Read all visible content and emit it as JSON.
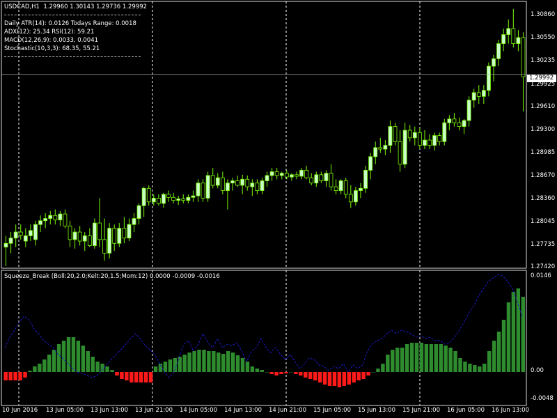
{
  "chart_header": {
    "symbol_line": "USDCAD,H1  1.29960 1.30143 1.29736 1.29992",
    "info_lines": [
      "Daily ATR(14): 0.0126 Todays Range: 0.0018",
      "ADX(12): 25.34 RSI(12): 59.21",
      "MACD(12,26,9): 0.0033, 0.0041",
      "Stochastic(10,3,3): 68.35, 55.21"
    ]
  },
  "colors": {
    "background": "#000000",
    "bull_candle": "#c8ffc8",
    "bear_candle": "#000000",
    "candle_wick": "#7cfc00",
    "momentum_up": "#2e8b2e",
    "momentum_down": "#ff1a1a",
    "bollinger_line": "#1c1cc8",
    "grid": "#ffffff",
    "current_price_bg": "#ffffff"
  },
  "current_price": "1.29992",
  "price_axis": [
    "1.30860",
    "1.30550",
    "1.30235",
    "1.29925",
    "1.29610",
    "1.29300",
    "1.28985",
    "1.28670",
    "1.28360",
    "1.28045",
    "1.27735",
    "1.27420"
  ],
  "indicator": {
    "label": "Squeeze_Break (Boll:20,2.0;Kelt:20,1.5;Mom:12) 0.0000 -0.0009 -0.0016",
    "axis": [
      "0.0146",
      "0.00",
      "-0.0048"
    ]
  },
  "time_axis": [
    "10 Jun 2016",
    "13 Jun 05:00",
    "13 Jun 13:00",
    "13 Jun 21:00",
    "14 Jun 05:00",
    "14 Jun 13:00",
    "14 Jun 21:00",
    "15 Jun 05:00",
    "15 Jun 13:00",
    "15 Jun 21:00",
    "16 Jun 05:00",
    "16 Jun 13:00"
  ],
  "chart_data": [
    {
      "type": "candlestick",
      "title": "USDCAD,H1  1.29960 1.30143 1.29736 1.29992",
      "ylim": [
        1.2742,
        1.3096
      ],
      "ohlc": [
        [
          1.277,
          1.2785,
          1.2745,
          1.2775
        ],
        [
          1.2775,
          1.279,
          1.2762,
          1.2782
        ],
        [
          1.2782,
          1.28,
          1.277,
          1.279
        ],
        [
          1.279,
          1.28,
          1.278,
          1.2786
        ],
        [
          1.2778,
          1.2795,
          1.277,
          1.2785
        ],
        [
          1.2785,
          1.28,
          1.2778,
          1.2792
        ],
        [
          1.278,
          1.2805,
          1.2772,
          1.28
        ],
        [
          1.28,
          1.2812,
          1.279,
          1.2805
        ],
        [
          1.2805,
          1.2815,
          1.2795,
          1.2808
        ],
        [
          1.2808,
          1.2818,
          1.28,
          1.2812
        ],
        [
          1.2812,
          1.282,
          1.28,
          1.2806
        ],
        [
          1.2806,
          1.2818,
          1.2798,
          1.2814
        ],
        [
          1.2814,
          1.282,
          1.2795,
          1.2798
        ],
        [
          1.2798,
          1.2805,
          1.277,
          1.278
        ],
        [
          1.278,
          1.2795,
          1.2768,
          1.279
        ],
        [
          1.279,
          1.2798,
          1.2772,
          1.2778
        ],
        [
          1.2778,
          1.279,
          1.2765,
          1.2785
        ],
        [
          1.2785,
          1.2795,
          1.277,
          1.2772
        ],
        [
          1.2772,
          1.2808,
          1.2768,
          1.2802
        ],
        [
          1.2802,
          1.2835,
          1.277,
          1.278
        ],
        [
          1.278,
          1.2808,
          1.2752,
          1.2762
        ],
        [
          1.2762,
          1.2802,
          1.2755,
          1.2795
        ],
        [
          1.2795,
          1.28,
          1.2765,
          1.2775
        ],
        [
          1.2775,
          1.2802,
          1.277,
          1.2795
        ],
        [
          1.2795,
          1.281,
          1.2775,
          1.2782
        ],
        [
          1.2782,
          1.2808,
          1.2778,
          1.28
        ],
        [
          1.28,
          1.2815,
          1.279,
          1.2808
        ],
        [
          1.2808,
          1.2828,
          1.28,
          1.2825
        ],
        [
          1.2825,
          1.285,
          1.281,
          1.2848
        ],
        [
          1.2848,
          1.2852,
          1.2825,
          1.283
        ],
        [
          1.283,
          1.284,
          1.2825,
          1.2835
        ],
        [
          1.2835,
          1.284,
          1.2825,
          1.2828
        ],
        [
          1.2828,
          1.2842,
          1.2822,
          1.284
        ],
        [
          1.284,
          1.2845,
          1.283,
          1.2836
        ],
        [
          1.2836,
          1.2842,
          1.2828,
          1.2832
        ],
        [
          1.2832,
          1.2838,
          1.2826,
          1.2834
        ],
        [
          1.2834,
          1.284,
          1.2828,
          1.2832
        ],
        [
          1.2832,
          1.284,
          1.2828,
          1.2836
        ],
        [
          1.2836,
          1.2845,
          1.283,
          1.2838
        ],
        [
          1.2838,
          1.286,
          1.283,
          1.2855
        ],
        [
          1.2855,
          1.286,
          1.283,
          1.2835
        ],
        [
          1.2835,
          1.287,
          1.283,
          1.2865
        ],
        [
          1.2865,
          1.2875,
          1.2848,
          1.2852
        ],
        [
          1.2852,
          1.2868,
          1.2848,
          1.2862
        ],
        [
          1.2862,
          1.287,
          1.284,
          1.2845
        ],
        [
          1.2845,
          1.286,
          1.282,
          1.2855
        ],
        [
          1.2855,
          1.2862,
          1.2845,
          1.2858
        ],
        [
          1.2858,
          1.2865,
          1.285,
          1.2852
        ],
        [
          1.2852,
          1.2866,
          1.284,
          1.286
        ],
        [
          1.286,
          1.2865,
          1.2845,
          1.285
        ],
        [
          1.285,
          1.286,
          1.2838,
          1.2855
        ],
        [
          1.2855,
          1.286,
          1.284,
          1.2845
        ],
        [
          1.2845,
          1.2862,
          1.284,
          1.2858
        ],
        [
          1.2858,
          1.287,
          1.285,
          1.2865
        ],
        [
          1.2865,
          1.2875,
          1.2858,
          1.287
        ],
        [
          1.287,
          1.2875,
          1.286,
          1.2865
        ],
        [
          1.2865,
          1.287,
          1.286,
          1.2868
        ],
        [
          1.2868,
          1.2872,
          1.286,
          1.2863
        ],
        [
          1.2863,
          1.2868,
          1.2858,
          1.2866
        ],
        [
          1.2866,
          1.287,
          1.286,
          1.2864
        ],
        [
          1.2864,
          1.2875,
          1.286,
          1.2872
        ],
        [
          1.2872,
          1.2878,
          1.286,
          1.2862
        ],
        [
          1.2862,
          1.2868,
          1.2852,
          1.2855
        ],
        [
          1.2855,
          1.287,
          1.285,
          1.2866
        ],
        [
          1.2866,
          1.287,
          1.2855,
          1.2858
        ],
        [
          1.2858,
          1.2872,
          1.285,
          1.2868
        ],
        [
          1.2868,
          1.288,
          1.2845,
          1.285
        ],
        [
          1.285,
          1.286,
          1.284,
          1.2845
        ],
        [
          1.2845,
          1.286,
          1.284,
          1.2858
        ],
        [
          1.2858,
          1.2862,
          1.2835,
          1.284
        ],
        [
          1.284,
          1.2852,
          1.2822,
          1.283
        ],
        [
          1.283,
          1.285,
          1.2825,
          1.2845
        ],
        [
          1.2845,
          1.2855,
          1.2835,
          1.2848
        ],
        [
          1.2848,
          1.2878,
          1.2842,
          1.2872
        ],
        [
          1.2872,
          1.2895,
          1.286,
          1.289
        ],
        [
          1.289,
          1.291,
          1.288,
          1.2902
        ],
        [
          1.2902,
          1.2915,
          1.2895,
          1.29
        ],
        [
          1.29,
          1.2912,
          1.2892,
          1.2905
        ],
        [
          1.2905,
          1.2938,
          1.2895,
          1.293
        ],
        [
          1.293,
          1.2935,
          1.2905,
          1.291
        ],
        [
          1.291,
          1.2925,
          1.287,
          1.288
        ],
        [
          1.288,
          1.2935,
          1.2875,
          1.2925
        ],
        [
          1.2925,
          1.2932,
          1.291,
          1.2915
        ],
        [
          1.2915,
          1.293,
          1.2905,
          1.2922
        ],
        [
          1.2922,
          1.2928,
          1.29,
          1.2905
        ],
        [
          1.2905,
          1.2925,
          1.29,
          1.2912
        ],
        [
          1.2912,
          1.292,
          1.29,
          1.2905
        ],
        [
          1.2905,
          1.2922,
          1.2898,
          1.2918
        ],
        [
          1.2918,
          1.2922,
          1.2905,
          1.291
        ],
        [
          1.291,
          1.294,
          1.2905,
          1.2935
        ],
        [
          1.2935,
          1.2945,
          1.2925,
          1.294
        ],
        [
          1.294,
          1.2948,
          1.293,
          1.2935
        ],
        [
          1.2935,
          1.2942,
          1.2925,
          1.293
        ],
        [
          1.293,
          1.294,
          1.292,
          1.2938
        ],
        [
          1.2938,
          1.297,
          1.293,
          1.2965
        ],
        [
          1.2965,
          1.298,
          1.2955,
          1.2975
        ],
        [
          1.2975,
          1.2985,
          1.296,
          1.297
        ],
        [
          1.297,
          1.2985,
          1.296,
          1.2978
        ],
        [
          1.2978,
          1.3015,
          1.297,
          1.301
        ],
        [
          1.301,
          1.3025,
          1.299,
          1.302
        ],
        [
          1.302,
          1.3045,
          1.301,
          1.304
        ],
        [
          1.304,
          1.306,
          1.303,
          1.3052
        ],
        [
          1.3052,
          1.3072,
          1.304,
          1.306
        ],
        [
          1.306,
          1.3086,
          1.3035,
          1.304
        ],
        [
          1.304,
          1.3058,
          1.303,
          1.3048
        ],
        [
          1.3048,
          1.3055,
          1.295,
          1.2996
        ]
      ]
    },
    {
      "type": "bar",
      "title": "Squeeze_Break (Boll:20,2.0;Kelt:20,1.5;Mom:12) 0.0000 -0.0009 -0.0016",
      "ylim": [
        -0.0048,
        0.0146
      ],
      "momentum": [
        -0.0012,
        -0.0012,
        -0.0012,
        -0.0012,
        -0.0008,
        0.0002,
        0.0008,
        0.0012,
        0.0018,
        0.0025,
        0.0032,
        0.004,
        0.0045,
        0.005,
        0.005,
        0.0045,
        0.0038,
        0.003,
        0.0022,
        0.0015,
        0.0012,
        0.0008,
        0.0003,
        -0.0005,
        -0.001,
        -0.0012,
        -0.0015,
        -0.0015,
        -0.0015,
        -0.0015,
        -0.0015,
        0.0008,
        0.0012,
        0.0015,
        0.0018,
        0.002,
        0.0022,
        0.0025,
        0.0028,
        0.003,
        0.0032,
        0.0032,
        0.003,
        0.003,
        0.0028,
        0.0026,
        0.003,
        0.0028,
        0.0024,
        0.002,
        0.0015,
        0.0008,
        0.0005,
        0.0003,
        0.0,
        -0.0003,
        -0.0005,
        -0.0003,
        -0.0002,
        0.0,
        -0.0003,
        -0.0005,
        -0.0008,
        -0.001,
        -0.0012,
        -0.0015,
        -0.0018,
        -0.002,
        -0.002,
        -0.0022,
        -0.002,
        -0.0018,
        -0.0015,
        -0.0012,
        -0.001,
        -0.0005,
        0.0,
        0.0005,
        0.0012,
        0.0025,
        0.0032,
        0.0035,
        0.0035,
        0.004,
        0.0042,
        0.0042,
        0.0042,
        0.004,
        0.004,
        0.004,
        0.004,
        0.0038,
        0.0035,
        0.003,
        0.002,
        0.0015,
        0.0012,
        0.001,
        0.0008,
        0.0012,
        0.003,
        0.0045,
        0.0058,
        0.0075,
        0.01,
        0.0115,
        0.012,
        0.0108
      ],
      "bollinger_ratio": [
        0.0035,
        0.005,
        0.006,
        0.0072,
        0.008,
        0.0075,
        0.0062,
        0.0055,
        0.0045,
        0.004,
        0.0035,
        0.0025,
        0.002,
        0.0012,
        0.0005,
        0.0,
        -0.0002,
        -0.0005,
        -0.0008,
        -0.0005,
        0.0002,
        0.001,
        0.0018,
        0.0025,
        0.0032,
        0.004,
        0.0048,
        0.0055,
        0.0048,
        0.0038,
        0.0032,
        0.0025,
        0.0012,
        0.0,
        -0.0008,
        0.0,
        0.002,
        0.004,
        0.0045,
        0.003,
        0.004,
        0.0055,
        0.0042,
        0.0035,
        0.0048,
        0.0035,
        0.004,
        0.0038,
        0.0042,
        0.003,
        0.0015,
        0.003,
        0.0035,
        0.0048,
        0.0035,
        0.0028,
        0.0035,
        0.0025,
        0.0018,
        0.0025,
        0.0015,
        0.0005,
        0.0012,
        0.002,
        0.0018,
        0.001,
        0.0008,
        0.0002,
        0.0008,
        0.0005,
        0.0012,
        0.0,
        0.001,
        0.0005,
        0.001,
        0.003,
        0.004,
        0.0045,
        0.0048,
        0.0055,
        0.006,
        0.0055,
        0.006,
        0.0058,
        0.0055,
        0.005,
        0.0052,
        0.0048,
        0.005,
        0.0045,
        0.0045,
        0.004,
        0.0042,
        0.005,
        0.006,
        0.0072,
        0.0085,
        0.0095,
        0.011,
        0.012,
        0.013,
        0.0135,
        0.014,
        0.0138,
        0.013,
        0.012,
        0.01,
        0.008
      ]
    }
  ]
}
